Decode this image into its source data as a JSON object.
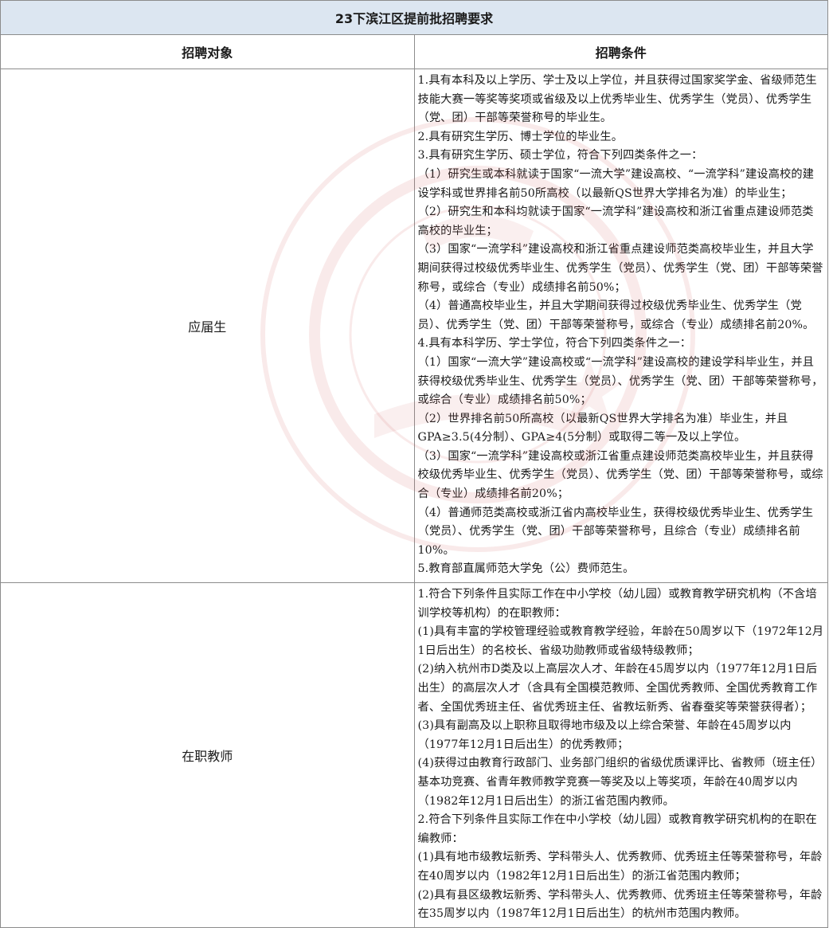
{
  "title": "23下滨江区提前批招聘要求",
  "headers": {
    "target": "招聘对象",
    "conditions": "招聘条件"
  },
  "rows": [
    {
      "target": "应届生",
      "lines": [
        "1.具有本科及以上学历、学士及以上学位，并且获得过国家奖学金、省级师范生技能大赛一等奖等奖项或省级及以上优秀毕业生、优秀学生（党员）、优秀学生（党、团）干部等荣誉称号的毕业生。",
        "2.具有研究生学历、博士学位的毕业生。",
        "3.具有研究生学历、硕士学位，符合下列四类条件之一：",
        "（1）研究生或本科就读于国家“一流大学”建设高校、“一流学科”建设高校的建设学科或世界排名前50所高校（以最新QS世界大学排名为准）的毕业生；",
        "（2）研究生和本科均就读于国家“一流学科”建设高校和浙江省重点建设师范类高校的毕业生；",
        "（3）国家“一流学科”建设高校和浙江省重点建设师范类高校毕业生，并且大学期间获得过校级优秀毕业生、优秀学生（党员）、优秀学生（党、团）干部等荣誉称号，或综合（专业）成绩排名前50%；",
        "（4）普通高校毕业生，并且大学期间获得过校级优秀毕业生、优秀学生（党员）、优秀学生（党、团）干部等荣誉称号，或综合（专业）成绩排名前20%。",
        "4.具有本科学历、学士学位，符合下列四类条件之一：",
        "（1）国家“一流大学”建设高校或“一流学科”建设高校的建设学科毕业生，并且获得校级优秀毕业生、优秀学生（党员）、优秀学生（党、团）干部等荣誉称号，或综合（专业）成绩排名前50%；",
        "（2）世界排名前50所高校（以最新QS世界大学排名为准）毕业生，并且GPA≥3.5(4分制）、GPA≥4(5分制）或取得二等一及以上学位。",
        "（3）国家“一流学科”建设高校或浙江省重点建设师范类高校毕业生，并且获得校级优秀毕业生、优秀学生（党员）、优秀学生（党、团）干部等荣誉称号，或综合（专业）成绩排名前20%；",
        "（4）普通师范类高校或浙江省内高校毕业生，获得校级优秀毕业生、优秀学生（党员）、优秀学生（党、团）干部等荣誉称号，且综合（专业）成绩排名前10%。",
        "5.教育部直属师范大学免（公）费师范生。"
      ]
    },
    {
      "target": "在职教师",
      "lines": [
        "1.符合下列条件且实际工作在中小学校（幼儿园）或教育教学研究机构（不含培训学校等机构）的在职教师：",
        "(1)具有丰富的学校管理经验或教育教学经验，年龄在50周岁以下（1972年12月1日后出生）的名校长、省级功勋教师或省级特级教师；",
        "(2)纳入杭州市D类及以上高层次人才、年龄在45周岁以内（1977年12月1日后出生）的高层次人才（含具有全国模范教师、全国优秀教师、全国优秀教育工作者、全国优秀班主任、省优秀班主任、省教坛新秀、省春蚕奖等荣誉获得者）；",
        "(3)具有副高及以上职称且取得地市级及以上综合荣誉、年龄在45周岁以内（1977年12月1日后出生）的优秀教师；",
        "(4)获得过由教育行政部门、业务部门组织的省级优质课评比、省教师（班主任）基本功竞赛、省青年教师教学竞赛一等奖及以上等奖项，年龄在40周岁以内（1982年12月1日后出生）的浙江省范围内教师。",
        "2.符合下列条件且实际工作在中小学校（幼儿园）或教育教学研究机构的在职在编教师：",
        "(1)具有地市级教坛新秀、学科带头人、优秀教师、优秀班主任等荣誉称号，年龄在40周岁以内（1982年12月1日后出生）的浙江省范围内教师；",
        "(2)具有县区级教坛新秀、学科带头人、优秀教师、优秀班主任等荣誉称号，年龄在35周岁以内（1987年12月1日后出生）的杭州市范围内教师。"
      ]
    }
  ]
}
